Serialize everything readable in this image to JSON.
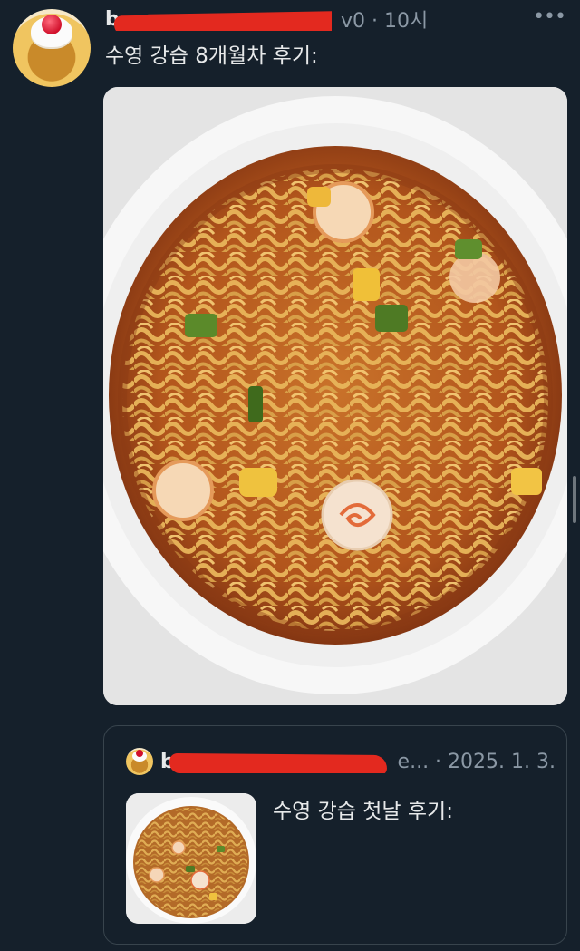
{
  "tweet": {
    "author_name": "b",
    "meta": "v0 · 10시",
    "more_icon": "more-dots-icon",
    "text": "수영 강습 8개월차 후기:",
    "image_icon": "ramen-cup-photo"
  },
  "quote": {
    "author_name": "b",
    "meta": "e... · 2025. 1. 3.",
    "text": "수영 강습 첫날 후기:",
    "image_icon": "ramen-cup-thumbnail"
  },
  "colors": {
    "background": "#15202b",
    "text": "#e7e9ea",
    "muted": "#8b98a5",
    "border": "#38444d",
    "redaction": "#e3291f"
  }
}
